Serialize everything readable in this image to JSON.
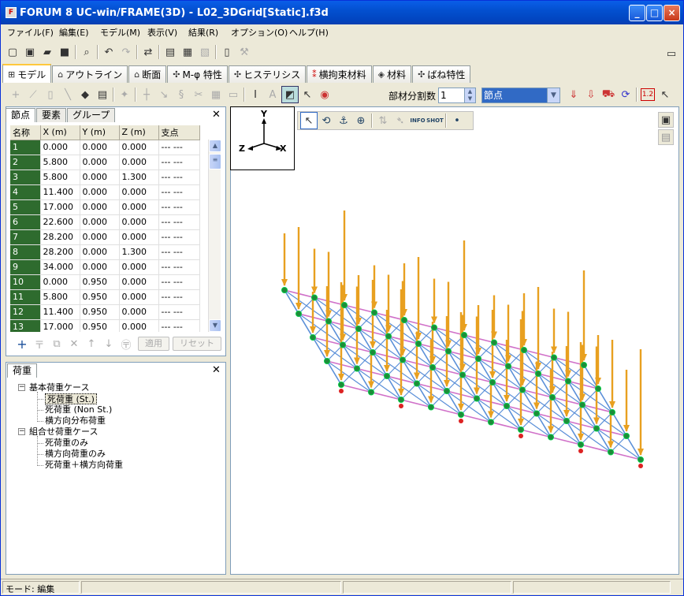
{
  "window": {
    "title": "FORUM 8  UC-win/FRAME(3D) - L02_3DGrid[Static].f3d"
  },
  "menu": [
    "ファイル(F)",
    "編集(E)",
    "モデル(M)",
    "表示(V)",
    "結果(R)",
    "オプション(O)",
    "ヘルプ(H)"
  ],
  "tabs": [
    {
      "label": "モデル",
      "icon": "model-icon"
    },
    {
      "label": "アウトライン",
      "icon": "outline-icon"
    },
    {
      "label": "断面",
      "icon": "section-icon"
    },
    {
      "label": "M-φ 特性",
      "icon": "m-phi-icon"
    },
    {
      "label": "ヒステリシス",
      "icon": "hysteresis-icon"
    },
    {
      "label": "横拘束材料",
      "icon": "lateral-material-icon"
    },
    {
      "label": "材料",
      "icon": "material-icon"
    },
    {
      "label": "ばね特性",
      "icon": "spring-icon"
    }
  ],
  "toolbar2": {
    "division_label": "部材分割数",
    "division_value": "1",
    "select_value": "節点",
    "badge": "1.2"
  },
  "left": {
    "subtabs": [
      "節点",
      "要素",
      "グループ"
    ],
    "columns": [
      "名称",
      "X (m)",
      "Y (m)",
      "Z (m)",
      "支点"
    ],
    "rows": [
      [
        "1",
        "0.000",
        "0.000",
        "0.000",
        "--- ---"
      ],
      [
        "2",
        "5.800",
        "0.000",
        "0.000",
        "--- ---"
      ],
      [
        "3",
        "5.800",
        "0.000",
        "1.300",
        "--- ---"
      ],
      [
        "4",
        "11.400",
        "0.000",
        "0.000",
        "--- ---"
      ],
      [
        "5",
        "17.000",
        "0.000",
        "0.000",
        "--- ---"
      ],
      [
        "6",
        "22.600",
        "0.000",
        "0.000",
        "--- ---"
      ],
      [
        "7",
        "28.200",
        "0.000",
        "0.000",
        "--- ---"
      ],
      [
        "8",
        "28.200",
        "0.000",
        "1.300",
        "--- ---"
      ],
      [
        "9",
        "34.000",
        "0.000",
        "0.000",
        "--- ---"
      ],
      [
        "10",
        "0.000",
        "0.950",
        "0.000",
        "--- ---"
      ],
      [
        "11",
        "5.800",
        "0.950",
        "0.000",
        "--- ---"
      ],
      [
        "12",
        "11.400",
        "0.950",
        "0.000",
        "--- ---"
      ],
      [
        "13",
        "17.000",
        "0.950",
        "0.000",
        "--- ---"
      ]
    ],
    "apply_label": "適用",
    "reset_label": "リセット"
  },
  "load": {
    "tab": "荷重",
    "tree": [
      {
        "label": "基本荷重ケース",
        "level": 0
      },
      {
        "label": "死荷重 (St.)",
        "level": 1,
        "selected": true
      },
      {
        "label": "死荷重 (Non St.)",
        "level": 1
      },
      {
        "label": "横方向分布荷重",
        "level": 1
      },
      {
        "label": "組合せ荷重ケース",
        "level": 0
      },
      {
        "label": "死荷重のみ",
        "level": 1
      },
      {
        "label": "横方向荷重のみ",
        "level": 1
      },
      {
        "label": "死荷重＋横方向荷重",
        "level": 1
      }
    ]
  },
  "view": {
    "axis_y": "Y",
    "axis_z": "Z",
    "axis_x": "X",
    "info": "INFO",
    "shot": "SHOT"
  },
  "status": {
    "mode": "モード: 編集"
  },
  "colors": {
    "load_arrow": "#E8A020",
    "node_green": "#1E8B3A",
    "member_blue": "#5A8FD8",
    "member_pink": "#D070C8"
  }
}
